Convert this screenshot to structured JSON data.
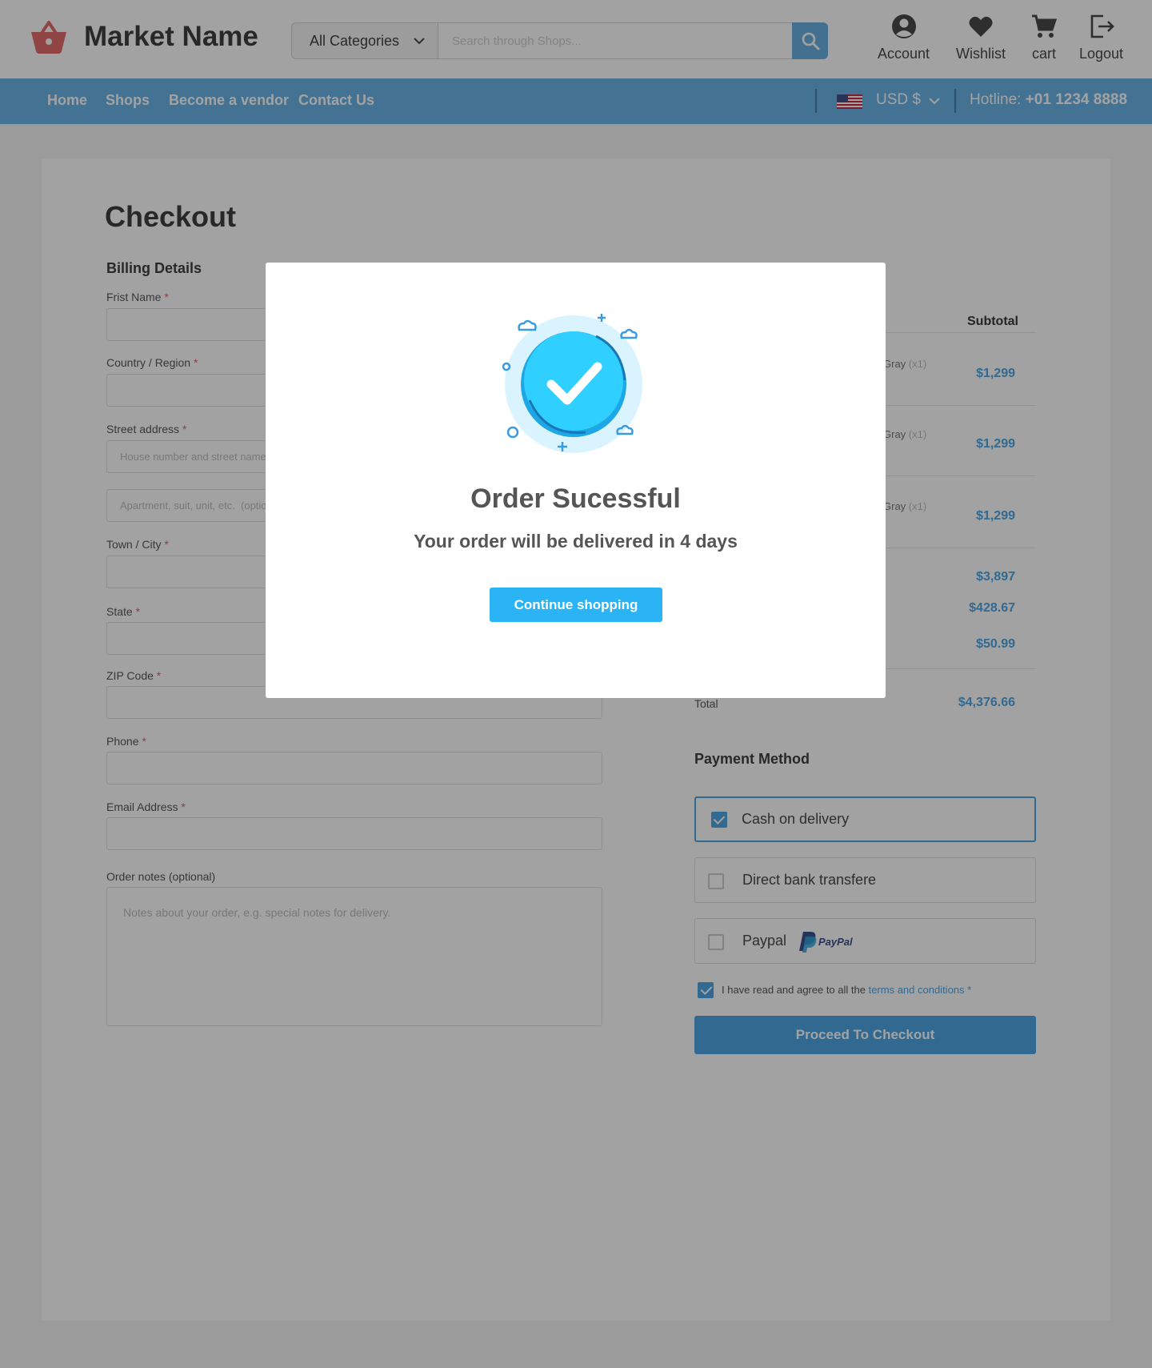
{
  "header": {
    "brand": "Market Name",
    "category_select": "All Categories",
    "search_placeholder": "Search through Shops...",
    "actions": [
      {
        "label": "Account",
        "icon": "account-icon"
      },
      {
        "label": "Wishlist",
        "icon": "heart-icon"
      },
      {
        "label": "cart",
        "icon": "cart-icon"
      },
      {
        "label": "Logout",
        "icon": "logout-icon"
      }
    ]
  },
  "nav": {
    "links": [
      "Home",
      "Shops",
      "Become a vendor",
      "Contact Us"
    ],
    "currency": "USD $",
    "hotline_label": "Hotline:",
    "hotline_number": "+01 1234 8888"
  },
  "checkout": {
    "title": "Checkout",
    "billing_title": "Billing Details",
    "fields": [
      {
        "label": "Frist Name",
        "required": "*",
        "placeholder": ""
      },
      {
        "label": "Country / Region",
        "required": "*",
        "placeholder": ""
      },
      {
        "label": "Street address",
        "required": "*",
        "placeholder": "House number and street name"
      },
      {
        "label": "",
        "required": "",
        "placeholder": "Apartment, suit, unit, etc.  (optional)"
      },
      {
        "label": "Town / City",
        "required": "*",
        "placeholder": ""
      },
      {
        "label": "State",
        "required": "*",
        "placeholder": ""
      },
      {
        "label": "ZIP Code",
        "required": "*",
        "placeholder": ""
      },
      {
        "label": "Phone",
        "required": "*",
        "placeholder": ""
      },
      {
        "label": "Email Address",
        "required": "*",
        "placeholder": ""
      }
    ],
    "notes_label": "Order notes (optional)",
    "notes_placeholder": "Notes about your order, e.g. special notes for delivery."
  },
  "summary": {
    "subtotal_header": "Subtotal",
    "items": [
      {
        "variant": "Gray",
        "qty": "(x1)",
        "price": "$1,299"
      },
      {
        "variant": "Gray",
        "qty": "(x1)",
        "price": "$1,299"
      },
      {
        "variant": "Gray",
        "qty": "(x1)",
        "price": "$1,299"
      }
    ],
    "amounts": [
      "$3,897",
      "$428.67",
      "$50.99"
    ],
    "total_label": "Total",
    "total_value": "$4,376.66"
  },
  "payment": {
    "title": "Payment Method",
    "options": [
      {
        "label": "Cash on delivery",
        "checked": true
      },
      {
        "label": "Direct bank transfere",
        "checked": false
      },
      {
        "label": "Paypal",
        "checked": false
      }
    ],
    "paypal_logo_text": "PayPal",
    "terms_text": "I have read and agree to all the ",
    "terms_link": "terms and conditions",
    "terms_req": " *",
    "checkout_button": "Proceed To Checkout"
  },
  "modal": {
    "title": "Order Sucessful",
    "subtitle": "Your order will be delivered in 4 days",
    "button": "Continue shopping"
  },
  "colors": {
    "accent": "#3b9be0",
    "nav": "#5aabe4",
    "modal_button": "#2bb4f5",
    "logo": "#e05a5a"
  }
}
